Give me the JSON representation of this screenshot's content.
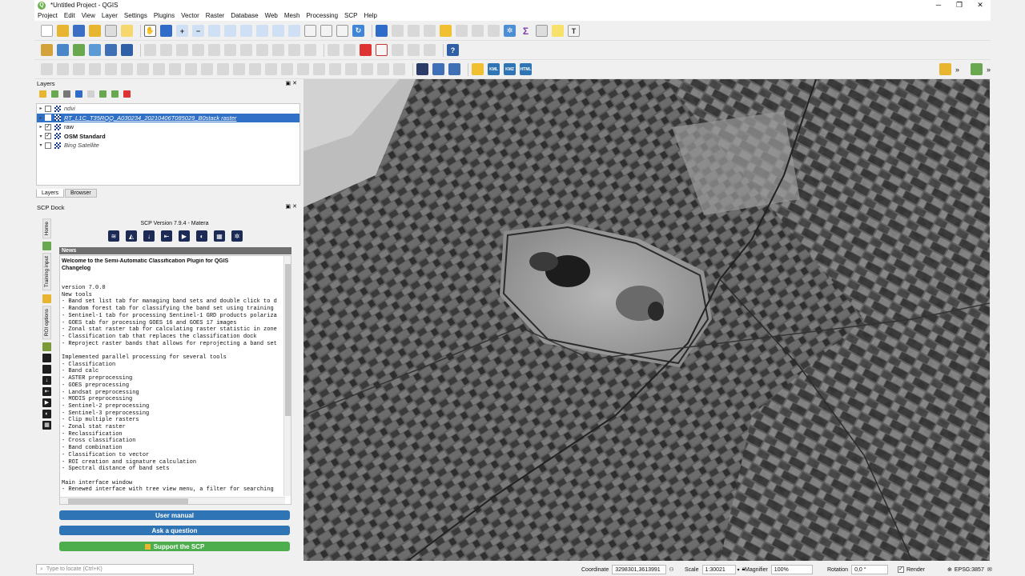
{
  "window": {
    "title": "*Untitled Project - QGIS",
    "controls": [
      "─",
      "❐",
      "✕"
    ]
  },
  "menu": [
    "Project",
    "Edit",
    "View",
    "Layer",
    "Settings",
    "Plugins",
    "Vector",
    "Raster",
    "Database",
    "Web",
    "Mesh",
    "Processing",
    "SCP",
    "Help"
  ],
  "layers_panel": {
    "title": "Layers",
    "layers": [
      {
        "name": "ndvi",
        "checked": false,
        "expanded": false,
        "style": "italic",
        "selected": false
      },
      {
        "name": "RT_L1C_T35RQQ_A030234_20210406T085029_B0stack raster",
        "checked": false,
        "expanded": false,
        "style": "italic",
        "selected": true
      },
      {
        "name": "raw",
        "checked": true,
        "expanded": false,
        "style": "normal",
        "selected": false
      },
      {
        "name": "OSM Standard",
        "checked": true,
        "expanded": true,
        "style": "bold",
        "selected": false
      },
      {
        "name": "Bing Satellite",
        "checked": false,
        "expanded": true,
        "style": "italic",
        "selected": false
      }
    ],
    "tabs": [
      "Layers",
      "Browser"
    ]
  },
  "scp_dock": {
    "title": "SCP Dock",
    "side_tabs": [
      "Home",
      "Training input",
      "ROI options"
    ],
    "version": "SCP Version 7.9.4 - Matera",
    "news_header": "News",
    "news_title": "Welcome to the Semi-Automatic Classification Plugin for QGIS Changelog",
    "news_lines": [
      "version 7.0.0",
      "New tools",
      "- Band set list tab for managing band sets and double click to d",
      "- Random forest tab for classifying the band set using training",
      "- Sentinel-1 tab for processing Sentinel-1 GRD products polariza",
      "- GOES tab for processing GOES 16 and GOES 17 images",
      "- Zonal stat raster tab for calculating raster statistic in zone",
      "- Classification tab that replaces the classification dock",
      "- Reproject raster bands that allows for reprojecting a band set",
      "",
      "Implemented parallel processing for several tools",
      "- Classification",
      "- Band calc",
      "- ASTER preprocessing",
      "- GOES preprocessing",
      "- Landsat preprocessing",
      "- MODIS preprocessing",
      "- Sentinel-2 preprocessing",
      "- Sentinel-3 preprocessing",
      "- Clip multiple rasters",
      "- Zonal stat raster",
      "- Reclassification",
      "- Cross classification",
      "- Band combination",
      "- Classification to vector",
      "- ROI creation and signature calculation",
      "- Spectral distance of band sets",
      "",
      "Main interface window",
      "- Renewed interface with tree view menu, a filter for searching"
    ],
    "buttons": {
      "manual": "User manual",
      "ask": "Ask a question",
      "support": "Support the SCP"
    }
  },
  "statusbar": {
    "locate_placeholder": "Type to locate (Ctrl+K)",
    "coordinate_label": "Coordinate",
    "coordinate": "3298301,3613991",
    "scale_label": "Scale",
    "scale": "1:30021",
    "magnifier_label": "Magnifier",
    "magnifier": "100%",
    "rotation_label": "Rotation",
    "rotation": "0,0 °",
    "render_label": "Render",
    "crs": "EPSG:3857"
  },
  "colors": {
    "selection": "#3071c7",
    "button_blue": "#2f74b5",
    "button_green": "#4cae4c"
  }
}
